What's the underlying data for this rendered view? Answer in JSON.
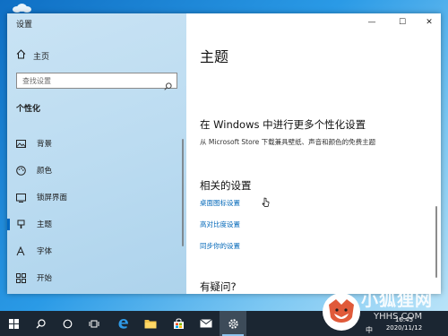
{
  "window": {
    "title": "设置",
    "controls": {
      "minimize": "—",
      "maximize": "☐",
      "close": "✕"
    }
  },
  "sidebar": {
    "home_label": "主页",
    "search_placeholder": "查找设置",
    "section_title": "个性化",
    "items": [
      {
        "label": "背景",
        "icon": "image-icon",
        "active": false
      },
      {
        "label": "颜色",
        "icon": "palette-icon",
        "active": false
      },
      {
        "label": "锁屏界面",
        "icon": "lockscreen-icon",
        "active": false
      },
      {
        "label": "主题",
        "icon": "theme-brush-icon",
        "active": true
      },
      {
        "label": "字体",
        "icon": "font-icon",
        "active": false
      },
      {
        "label": "开始",
        "icon": "start-icon",
        "active": false
      }
    ]
  },
  "main": {
    "page_title": "主题",
    "store_heading": "在 Windows 中进行更多个性化设置",
    "store_desc": "从 Microsoft Store 下载兼具壁纸、声音和颜色的免费主题",
    "related_heading": "相关的设置",
    "links": [
      "桌面图标设置",
      "高对比度设置",
      "同步你的设置"
    ],
    "help_heading": "有疑问?"
  },
  "taskbar": {
    "time": "16:45",
    "date": "2020/11/12",
    "input_indicator": "中",
    "icons": [
      "windows-start-icon",
      "search-icon",
      "cortana-icon",
      "task-view-icon",
      "edge-icon",
      "file-explorer-icon",
      "store-icon",
      "mail-icon",
      "settings-gear-icon"
    ]
  },
  "watermark": {
    "text": "小狐狸网",
    "url": "YHHS.COM"
  },
  "colors": {
    "accent": "#0067c0",
    "link": "#0067b8",
    "taskbar": "#1b2632",
    "sidebar": "#bcdcf1"
  }
}
